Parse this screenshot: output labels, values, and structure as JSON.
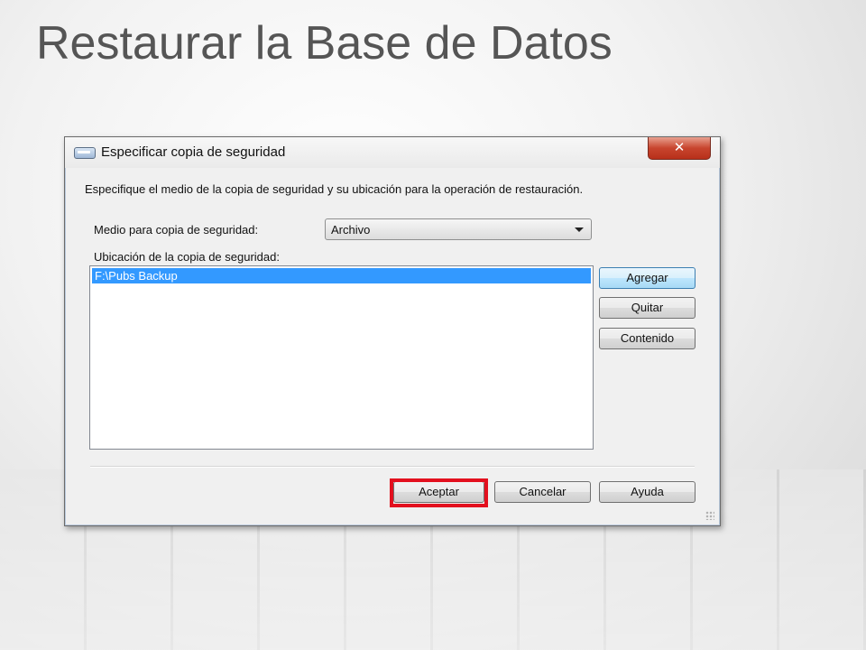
{
  "slide": {
    "title": "Restaurar la Base de Datos"
  },
  "dialog": {
    "title": "Especificar copia de seguridad",
    "close_label": "✕",
    "instructions": "Especifique el medio de la copia de seguridad y su ubicación para la operación de restauración.",
    "media_label": "Medio para copia de seguridad:",
    "media_selected": "Archivo",
    "location_label": "Ubicación de la copia de seguridad:",
    "locations": [
      "F:\\Pubs Backup"
    ],
    "side_buttons": {
      "add": "Agregar",
      "remove": "Quitar",
      "contents": "Contenido"
    },
    "footer_buttons": {
      "ok": "Aceptar",
      "cancel": "Cancelar",
      "help": "Ayuda"
    }
  },
  "colors": {
    "selection": "#3399ff",
    "highlight": "#e3101e",
    "close_button": "#c8452e",
    "title_text": "#555555"
  },
  "icons": {
    "dialog_icon": "backup-device-icon",
    "close": "close-icon",
    "dropdown": "chevron-down-icon"
  }
}
